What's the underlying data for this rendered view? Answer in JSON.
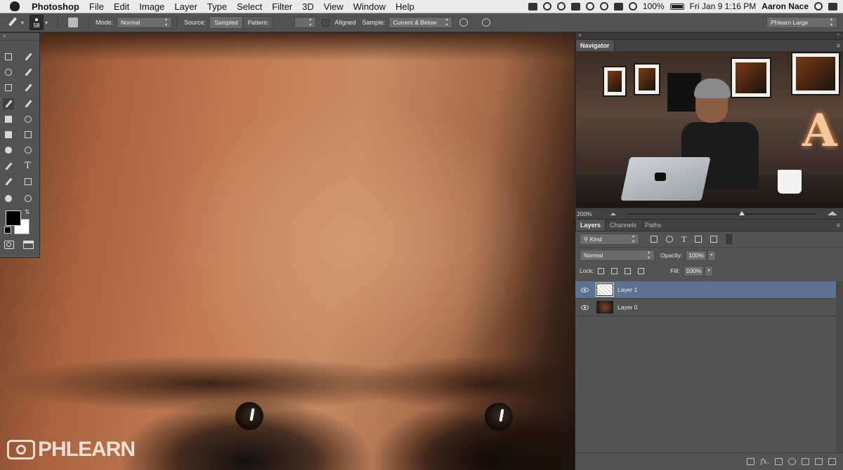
{
  "menubar": {
    "app_name": "Photoshop",
    "menus": [
      "File",
      "Edit",
      "Image",
      "Layer",
      "Type",
      "Select",
      "Filter",
      "3D",
      "View",
      "Window",
      "Help"
    ],
    "battery": "100%",
    "clock": "Fri Jan 9  1:16 PM",
    "user": "Aaron Nace"
  },
  "options": {
    "brush_size": "58",
    "mode_label": "Mode:",
    "mode_value": "Normal",
    "source_label": "Source:",
    "source_sampled": "Sampled",
    "source_pattern": "Pattern:",
    "aligned_label": "Aligned",
    "sample_label": "Sample:",
    "sample_value": "Current & Below",
    "workspace": "Phlearn Large"
  },
  "canvas": {
    "watermark": "PHLEARN"
  },
  "navigator": {
    "title": "Navigator",
    "zoom": "200%"
  },
  "layers_panel": {
    "tabs": [
      "Layers",
      "Channels",
      "Paths"
    ],
    "kind_filter": "Kind",
    "blend_mode": "Normal",
    "opacity_label": "Opacity:",
    "opacity": "100%",
    "lock_label": "Lock:",
    "fill_label": "Fill:",
    "fill": "100%",
    "layers": [
      {
        "name": "Layer 1",
        "selected": true,
        "thumbnail": "transparent"
      },
      {
        "name": "Layer 0",
        "selected": false,
        "thumbnail": "photo"
      }
    ],
    "footer_fx": "fx."
  },
  "colors": {
    "foreground": "#000000",
    "background": "#ffffff",
    "selected_layer": "#5d7191",
    "panel_bg": "#535353"
  },
  "icons": {
    "tray": [
      "facetime-icon",
      "notification-bell-icon",
      "creative-cloud-icon",
      "evernote-icon",
      "skype-icon",
      "sync-icon",
      "airplay-icon",
      "wifi-icon",
      "battery-icon",
      "search-icon",
      "list-icon"
    ],
    "tools": [
      "marquee-icon",
      "move-icon",
      "lasso-icon",
      "magic-wand-icon",
      "crop-icon",
      "eyedropper-icon",
      "spot-healing-brush-icon",
      "brush-icon",
      "clone-stamp-icon",
      "history-brush-icon",
      "eraser-icon",
      "gradient-icon",
      "blur-icon",
      "dodge-icon",
      "pen-icon",
      "type-icon",
      "path-selection-icon",
      "rectangle-shape-icon",
      "hand-icon",
      "zoom-icon"
    ]
  }
}
